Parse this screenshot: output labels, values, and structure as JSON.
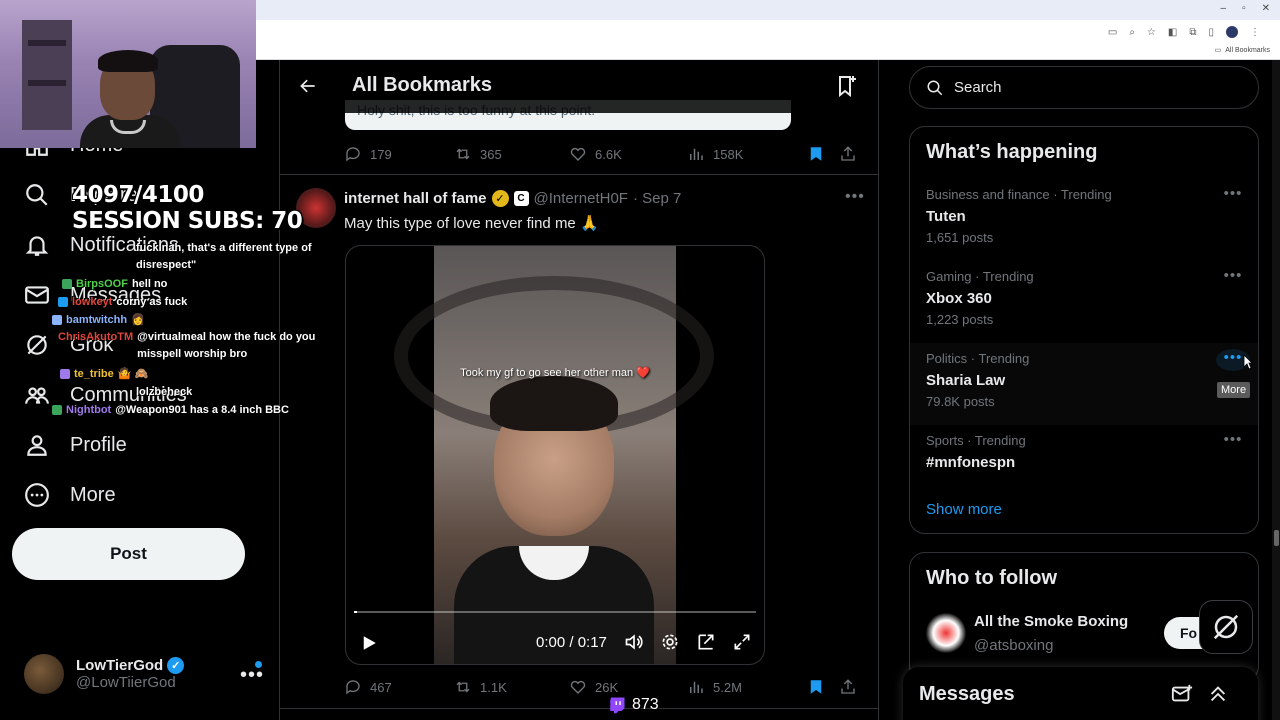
{
  "browser": {
    "window_controls": [
      "–",
      "▫",
      "✕"
    ],
    "bookmarks_label": "All Bookmarks"
  },
  "overlay": {
    "sub_goal": "4097/4100",
    "session_subs": "SESSION SUBS: 70",
    "viewer_count": "873",
    "chat": [
      {
        "user": "",
        "message": "fuck nah, that's a different type of disrespect\"",
        "color": "#ffffff"
      },
      {
        "user": "BirpsOOF",
        "message": "hell no",
        "color": "#4fd14a"
      },
      {
        "user": "lowkeyt",
        "message": "corny as fuck",
        "color": "#e0463a"
      },
      {
        "user": "bamtwitchh",
        "message": "",
        "color": "#8ab4ff"
      },
      {
        "user": "ChrisAkutoTM",
        "message": "@virtualmeal how the fuck do you misspell worship bro",
        "color": "#e0463a"
      },
      {
        "user": "te_tribe",
        "message": "",
        "color": "#f0c23a"
      },
      {
        "user": "",
        "message": "lolzbeheck",
        "color": "#ffffff"
      },
      {
        "user": "Nightbot",
        "message": "@Weapon901 has a 8.4 inch BBC",
        "color": "#9f7aea"
      }
    ]
  },
  "nav": {
    "items": [
      {
        "label": "Home",
        "icon": "home-icon"
      },
      {
        "label": "Explore",
        "icon": "search-icon"
      },
      {
        "label": "Notifications",
        "icon": "bell-icon"
      },
      {
        "label": "Messages",
        "icon": "mail-icon"
      },
      {
        "label": "Grok",
        "icon": "grok-icon"
      },
      {
        "label": "Communities",
        "icon": "communities-icon"
      },
      {
        "label": "Profile",
        "icon": "profile-icon"
      },
      {
        "label": "More",
        "icon": "more-circle-icon"
      }
    ],
    "post_label": "Post",
    "account": {
      "name": "LowTierGod",
      "handle": "@LowTiierGod"
    }
  },
  "main": {
    "title": "All Bookmarks",
    "quote_remnant": "Holy shit, this is too funny at this point.",
    "tweet1_actions": {
      "replies": "179",
      "reposts": "365",
      "likes": "6.6K",
      "views": "158K"
    },
    "tweet2": {
      "name": "internet hall of fame",
      "handle": "@InternetH0F",
      "date": "· Sep 7",
      "text": "May this type of love never find me 🙏",
      "video_caption": "Took my gf to go see her other man ❤️",
      "video_time": "0:00 / 0:17",
      "video_progress": 0.0,
      "actions": {
        "replies": "467",
        "reposts": "1.1K",
        "likes": "26K",
        "views": "5.2M"
      }
    }
  },
  "right": {
    "search_placeholder": "Search",
    "trends_title": "What’s happening",
    "trends": [
      {
        "meta": "Business and finance · Trending",
        "name": "Tuten",
        "count": "1,651 posts"
      },
      {
        "meta": "Gaming · Trending",
        "name": "Xbox 360",
        "count": "1,223 posts"
      },
      {
        "meta": "Politics · Trending",
        "name": "Sharia Law",
        "count": "79.8K posts"
      },
      {
        "meta": "Sports · Trending",
        "name": "#mnfonespn",
        "count": ""
      }
    ],
    "more_tooltip": "More",
    "show_more": "Show more",
    "follow_title": "Who to follow",
    "follow": {
      "name": "All the Smoke Boxing",
      "handle": "@atsboxing",
      "button": "Fo"
    },
    "messages_title": "Messages"
  },
  "colors": {
    "accent": "#1d9bf0",
    "bg": "#000000",
    "text": "#e7e9ea",
    "muted": "#71767b"
  }
}
